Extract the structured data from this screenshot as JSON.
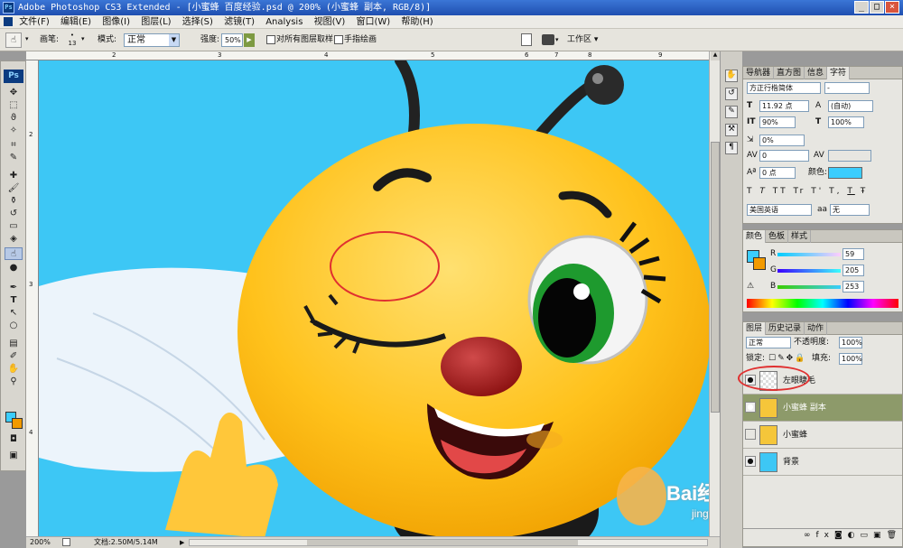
{
  "window": {
    "title": "Adobe Photoshop CS3 Extended - [小蜜蜂  百度经验.psd @ 200% (小蜜蜂 副本, RGB/8)]",
    "ps_logo": "Ps",
    "controls": [
      "_",
      "□",
      "×"
    ]
  },
  "menu": [
    "文件(F)",
    "编辑(E)",
    "图像(I)",
    "图层(L)",
    "选择(S)",
    "滤镜(T)",
    "Analysis",
    "视图(V)",
    "窗口(W)",
    "帮助(H)"
  ],
  "options": {
    "brush_label": "画笔:",
    "brush_size": "13",
    "mode_label": "模式:",
    "mode_value": "正常",
    "strength_label": "强度:",
    "strength_value": "50%",
    "sample_all": "对所有图层取样",
    "finger_paint": "手指绘画",
    "workspace": "工作区"
  },
  "ruler": {
    "top": [
      "2",
      "3",
      "4",
      "5",
      "6",
      "7",
      "8",
      "9"
    ],
    "left": [
      "2",
      "3",
      "4"
    ]
  },
  "status": {
    "zoom": "200%",
    "doc": "文档:2.50M/5.14M"
  },
  "watermark": {
    "brand": "Bai经验",
    "url": "jingyan.baidu.com"
  },
  "char_panel": {
    "tabs": [
      "导航器",
      "直方图",
      "信息",
      "字符"
    ],
    "font_family": "方正行楷简体",
    "font_style": "-",
    "font_size": "11.92 点",
    "leading": "(自动)",
    "v_scale": "90%",
    "h_scale": "100%",
    "tracking_pct": "0%",
    "kerning": "0",
    "baseline": "0 点",
    "color_label": "颜色:",
    "style_buttons": [
      "T",
      "T",
      "TT",
      "Tr",
      "T'",
      "T,",
      "T",
      "Ŧ"
    ],
    "language": "美国英语",
    "aa_label": "aa",
    "antialias": "无"
  },
  "color_panel": {
    "tabs": [
      "颜色",
      "色板",
      "样式"
    ],
    "channels": [
      {
        "name": "R",
        "value": "59"
      },
      {
        "name": "G",
        "value": "205"
      },
      {
        "name": "B",
        "value": "253"
      }
    ],
    "fg": "#3bcdfd",
    "bg": "#f29a00"
  },
  "layers_panel": {
    "tabs": [
      "图层",
      "历史记录",
      "动作"
    ],
    "blend": "正常",
    "opacity_label": "不透明度:",
    "opacity": "100%",
    "lock_label": "锁定:",
    "fill_label": "填充:",
    "fill": "100%",
    "layers": [
      {
        "name": "左眼睫毛",
        "visible": true,
        "selected": false
      },
      {
        "name": "小蜜蜂 副本",
        "visible": true,
        "selected": true
      },
      {
        "name": "小蜜蜂",
        "visible": false,
        "selected": false
      },
      {
        "name": "背景",
        "visible": true,
        "selected": false
      }
    ]
  },
  "colors": {
    "canvas_bg": "#3dc7f5",
    "selected_layer": "#8d9a6a",
    "annotation": "#e03030"
  }
}
